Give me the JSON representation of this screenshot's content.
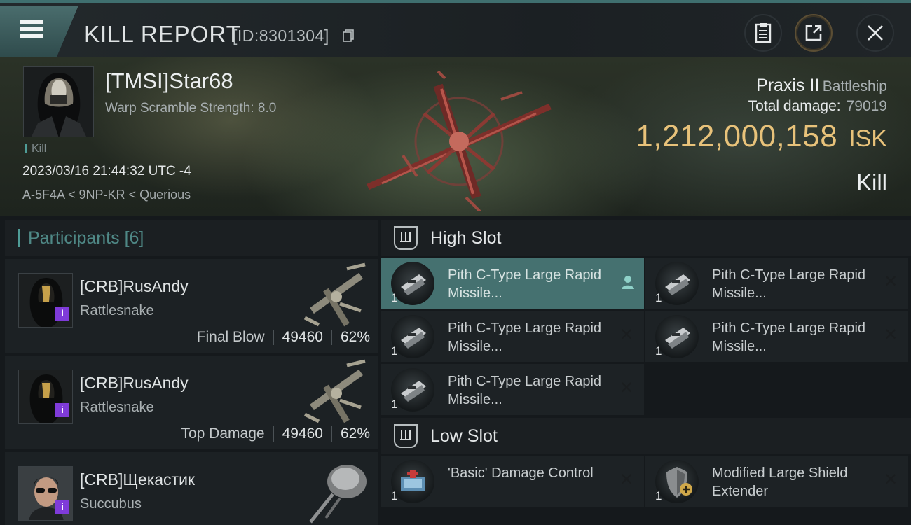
{
  "header": {
    "title": "KILL REPORT",
    "id_label": "[ID:8301304]",
    "buttons": [
      "menu-icon",
      "clipboard-icon",
      "share-icon",
      "close-icon"
    ]
  },
  "victim": {
    "name": "[TMSI]Star68",
    "warp_scramble": "Warp Scramble Strength: 8.0",
    "kill_tag": "Kill",
    "timestamp": "2023/03/16 21:44:32 UTC -4",
    "location": "A-5F4A < 9NP-KR < Querious",
    "ship_name": "Praxis II",
    "ship_class": "Battleship",
    "total_damage_label": "Total damage:",
    "total_damage": "79019",
    "isk_value": "1,212,000,158",
    "isk_unit": "ISK",
    "result": "Kill"
  },
  "participants": {
    "title": "Participants",
    "count": "[6]",
    "items": [
      {
        "name": "[CRB]RusAndy",
        "ship": "Rattlesnake",
        "role": "Final Blow",
        "damage": "49460",
        "percent": "62%",
        "badge": "i"
      },
      {
        "name": "[CRB]RusAndy",
        "ship": "Rattlesnake",
        "role": "Top Damage",
        "damage": "49460",
        "percent": "62%",
        "badge": "i"
      },
      {
        "name": "[CRB]Щекастик",
        "ship": "Succubus",
        "badge": "i"
      }
    ]
  },
  "fitting": {
    "high_slot": {
      "title": "High Slot",
      "modules": [
        {
          "name": "Pith C-Type Large Rapid Missile...",
          "qty": "1",
          "state": "selected"
        },
        {
          "name": "Pith C-Type Large Rapid Missile...",
          "qty": "1",
          "state": "destroyed"
        },
        {
          "name": "Pith C-Type Large Rapid Missile...",
          "qty": "1",
          "state": "destroyed"
        },
        {
          "name": "Pith C-Type Large Rapid Missile...",
          "qty": "1",
          "state": "destroyed"
        },
        {
          "name": "Pith C-Type Large Rapid Missile...",
          "qty": "1",
          "state": "destroyed"
        }
      ]
    },
    "low_slot": {
      "title": "Low Slot",
      "modules": [
        {
          "name": "'Basic' Damage Control",
          "qty": "1",
          "state": "destroyed"
        },
        {
          "name": "Modified Large Shield Extender",
          "qty": "1",
          "state": "destroyed"
        }
      ]
    },
    "destroyed_mark": "✕",
    "colors": {
      "accent": "#4f9c97",
      "isk": "#e8c27a",
      "selected": "#457170",
      "badge": "#7f3bd9"
    }
  }
}
